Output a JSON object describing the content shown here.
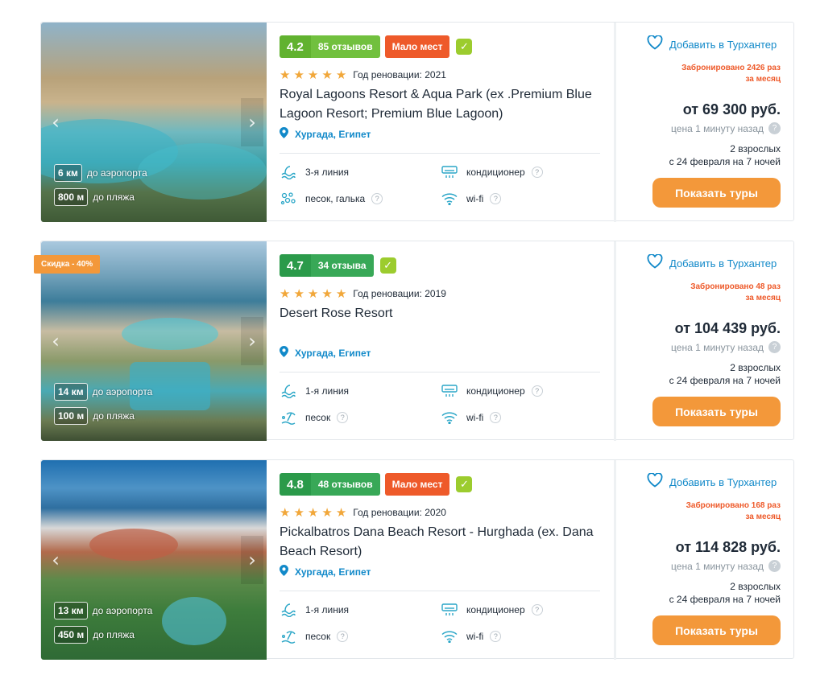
{
  "common": {
    "favorite_label": "Добавить в Турхантер",
    "price_ago": "цена 1 минуту назад",
    "button_label": "Показать туры",
    "airport_suffix": "до аэропорта",
    "beach_suffix": "до пляжа",
    "renovation_prefix": "Год реновации:",
    "q": "?",
    "check": "✓",
    "star": "★",
    "arrow_left": "‹",
    "arrow_right": "›",
    "heart": "♡",
    "pin": "⚲"
  },
  "colors": {
    "accent_orange": "#f3983a",
    "alert_red": "#ee5a2a",
    "link_blue": "#1189c9",
    "rating_green": "#61b22f"
  },
  "hotels": [
    {
      "score": "4.2",
      "reviews": "85 отзывов",
      "few_places": "Мало мест",
      "stars": 5,
      "renovation_year": "2021",
      "name": "Royal Lagoons Resort & Aqua Park (ex .Premium Blue Lagoon Resort; Premium Blue Lagoon)",
      "location": "Хургада, Египет",
      "airport_dist": "6 км",
      "beach_dist": "800 м",
      "line": "3-я линия",
      "ac": "кондиционер",
      "beach": "песок, галька",
      "wifi": "wi-fi",
      "booked_line1": "Забронировано 2426 раз",
      "booked_line2": "за месяц",
      "price": "от 69 300 руб.",
      "pax_line1": "2 взрослых",
      "pax_line2": "с 24 февраля на 7 ночей"
    },
    {
      "sale": "Скидка - 40%",
      "score": "4.7",
      "reviews": "34 отзыва",
      "stars": 5,
      "renovation_year": "2019",
      "name": "Desert Rose Resort",
      "location": "Хургада, Египет",
      "airport_dist": "14 км",
      "beach_dist": "100 м",
      "line": "1-я линия",
      "ac": "кондиционер",
      "beach": "песок",
      "wifi": "wi-fi",
      "booked_line1": "Забронировано 48 раз",
      "booked_line2": "за месяц",
      "price": "от 104 439 руб.",
      "pax_line1": "2 взрослых",
      "pax_line2": "с 24 февраля на 7 ночей"
    },
    {
      "score": "4.8",
      "reviews": "48 отзывов",
      "few_places": "Мало мест",
      "stars": 5,
      "renovation_year": "2020",
      "name": "Pickalbatros Dana Beach Resort - Hurghada (ex. Dana Beach Resort)",
      "location": "Хургада, Египет",
      "airport_dist": "13 км",
      "beach_dist": "450 м",
      "line": "1-я линия",
      "ac": "кондиционер",
      "beach": "песок",
      "wifi": "wi-fi",
      "booked_line1": "Забронировано 168 раз",
      "booked_line2": "за месяц",
      "price": "от 114 828 руб.",
      "pax_line1": "2 взрослых",
      "pax_line2": "с 24 февраля на 7 ночей"
    }
  ]
}
